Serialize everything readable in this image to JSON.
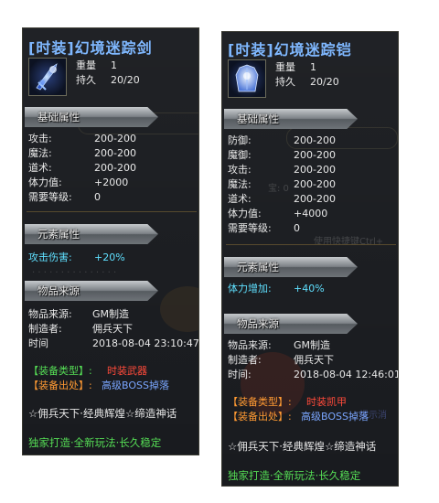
{
  "sword": {
    "title": "[时装]幻境迷踪剑",
    "weight_label": "重量",
    "weight_value": "1",
    "durability_label": "持久",
    "durability_value": "20/20",
    "base_section": "基础属性",
    "stats": [
      {
        "label": "攻击:",
        "value": "200-200"
      },
      {
        "label": "魔法:",
        "value": "200-200"
      },
      {
        "label": "道术:",
        "value": "200-200"
      },
      {
        "label": "体力值:",
        "value": "+2000"
      },
      {
        "label": "需要等级:",
        "value": "0"
      }
    ],
    "element_section": "元素属性",
    "element_label": "攻击伤害:",
    "element_value": "+20%",
    "source_section": "物品来源",
    "source_label": "物品来源:",
    "source_value": "GM制造",
    "maker_label": "制造者:",
    "maker_value": "佣兵天下",
    "time_label": "时间",
    "time_value": "2018-08-04 23:10:47",
    "type_label": "【装备类型】:",
    "type_value": "时装武器",
    "drop_label": "【装备出处】:",
    "drop_value": "高级BOSS掉落",
    "slogan": "☆佣兵天下·经典辉煌☆缔造神话",
    "footer": "独家打造·全新玩法·长久稳定"
  },
  "armor": {
    "title": "[时装]幻境迷踪铠",
    "weight_label": "重量",
    "weight_value": "1",
    "durability_label": "持久",
    "durability_value": "20/20",
    "base_section": "基础属性",
    "stats": [
      {
        "label": "防御:",
        "value": "200-200"
      },
      {
        "label": "魔御:",
        "value": "200-200"
      },
      {
        "label": "攻击:",
        "value": "200-200"
      },
      {
        "label": "魔法:",
        "value": "200-200"
      },
      {
        "label": "道术:",
        "value": "200-200"
      },
      {
        "label": "体力值:",
        "value": "+4000"
      },
      {
        "label": "需要等级:",
        "value": "0"
      }
    ],
    "element_section": "元素属性",
    "element_label": "体力增加:",
    "element_value": "+40%",
    "source_section": "物品来源",
    "source_label": "物品来源:",
    "source_value": "GM制造",
    "maker_label": "制造者:",
    "maker_value": "佣兵天下",
    "time_label": "时间:",
    "time_value": "2018-08-04 12:46:01",
    "type_label": "【装备类型】:",
    "type_value": "时装凯甲",
    "drop_label": "【装备出处】:",
    "drop_value": "高级BOSS掉落",
    "slogan": "☆佣兵天下·经典辉煌☆缔造神话",
    "footer": "独家打造·全新玩法·长久稳定"
  },
  "colors": {
    "title": "#7fb8ff",
    "element": "#5fe0ff",
    "source_label": "#ff9a33",
    "type_value": "#ff4a3a",
    "drop_value": "#7aa6ff",
    "footer": "#55dd55",
    "time": "#ffd84a"
  },
  "icons": {
    "sword": "sword-icon",
    "armor": "armor-icon"
  }
}
